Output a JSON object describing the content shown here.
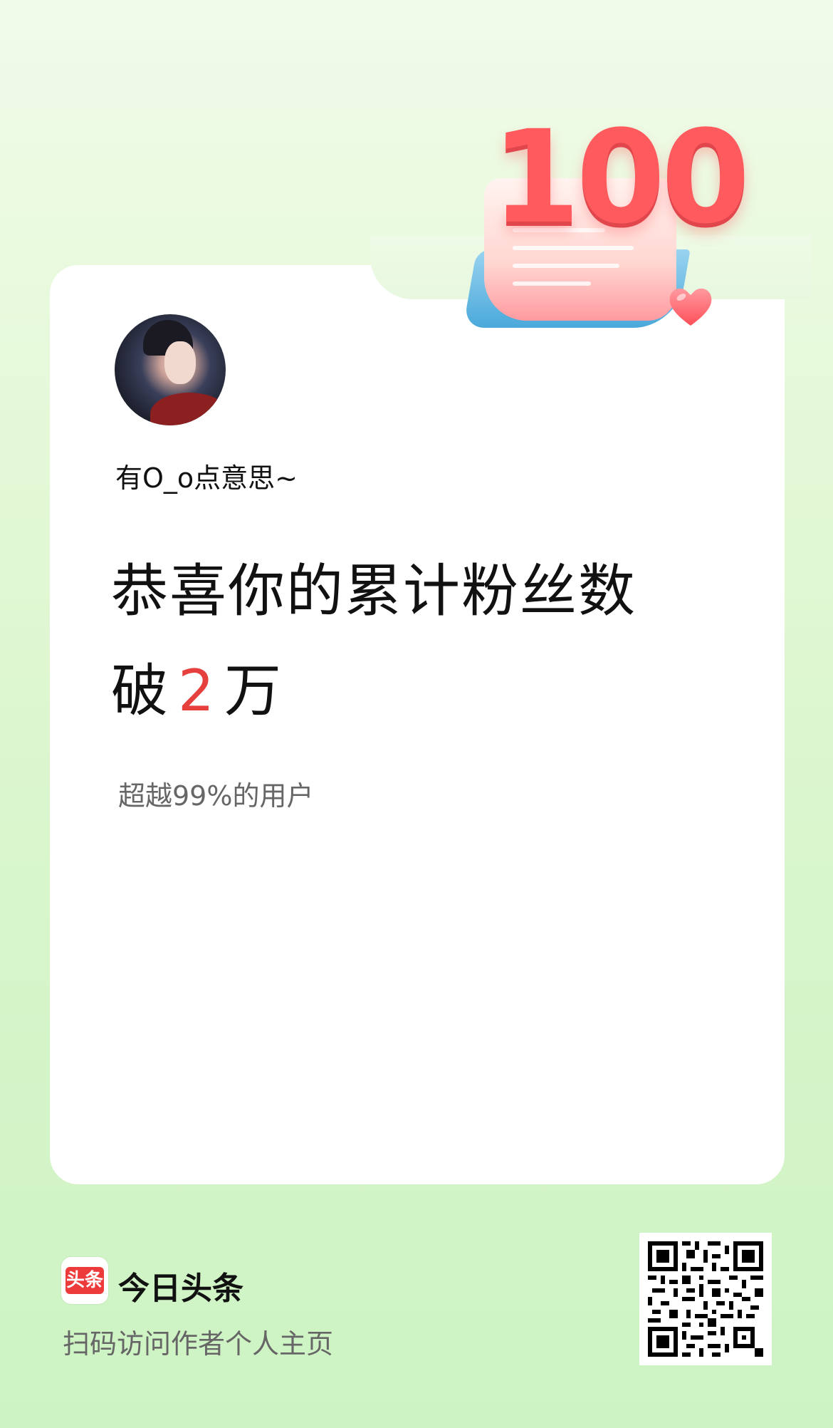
{
  "profile": {
    "username": "有O_o点意思~"
  },
  "milestone": {
    "badge_number": "100",
    "headline_line1": "恭喜你的累计粉丝数",
    "headline_prefix": "破",
    "headline_number": "2",
    "headline_suffix": "万",
    "subtext": "超越99%的用户"
  },
  "footer": {
    "logo_text": "头条",
    "brand_name": "今日头条",
    "scan_text": "扫码访问作者个人主页"
  },
  "colors": {
    "accent_red": "#e5403e",
    "background_green": "#d5f5c9",
    "brand_red": "#ed3a3a"
  }
}
